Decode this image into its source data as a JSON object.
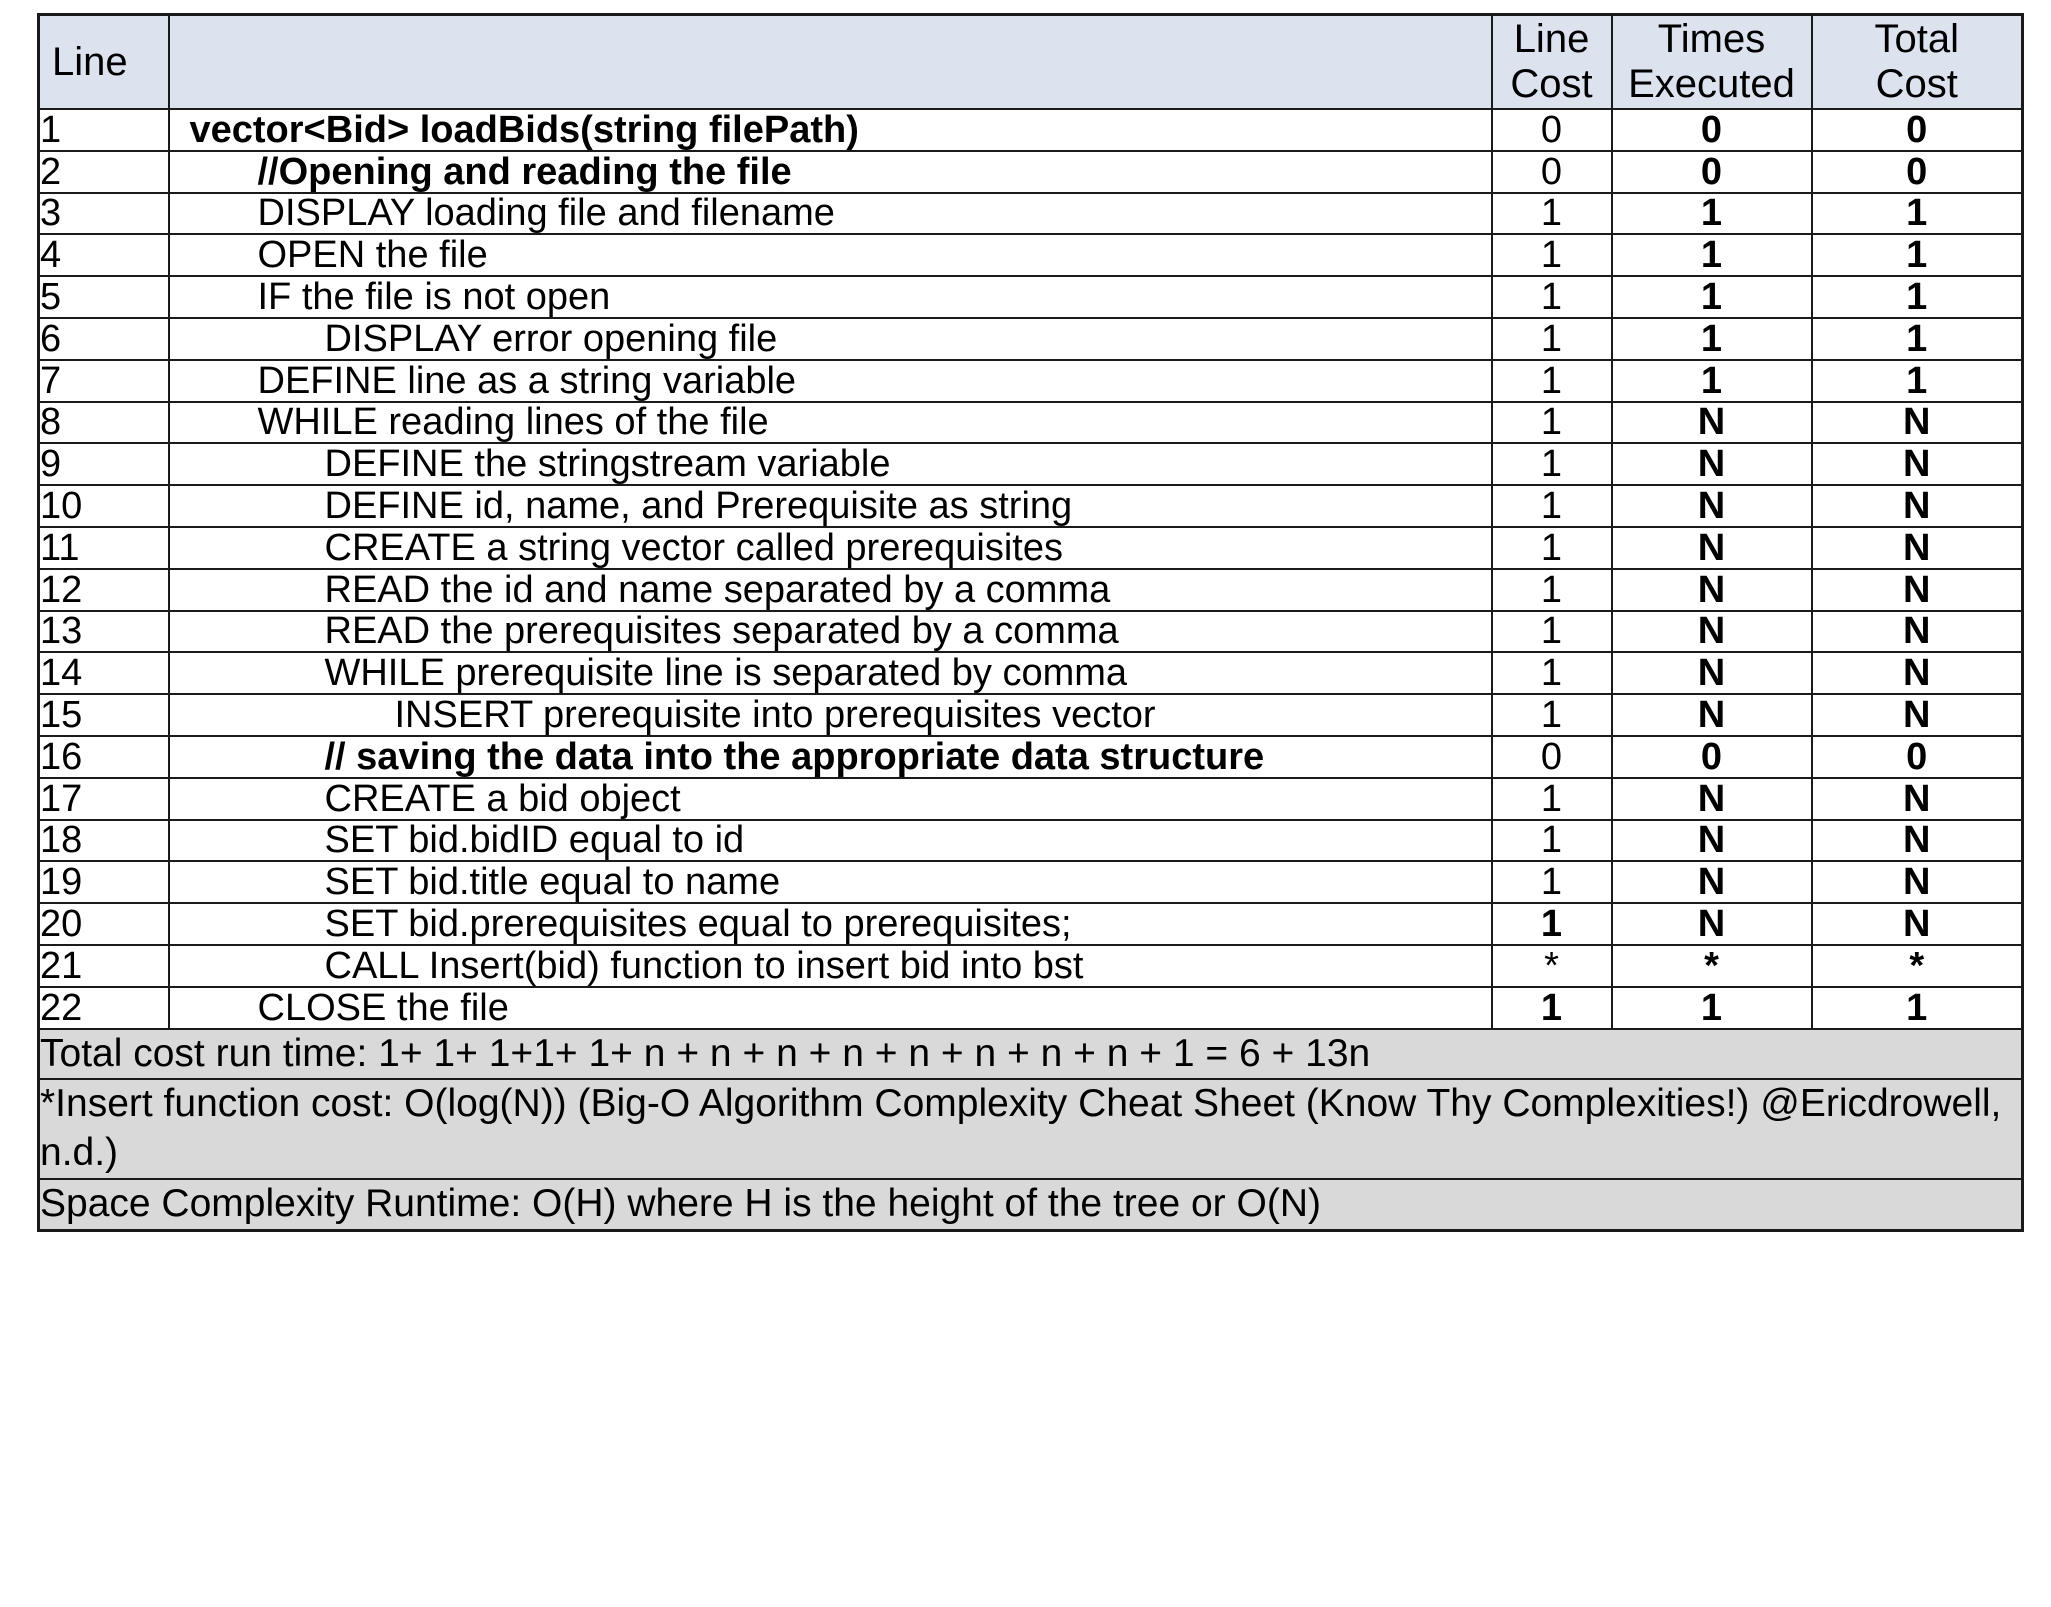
{
  "table": {
    "headers": {
      "line": "Line",
      "pseudocode": "",
      "line_cost": "Line\nCost",
      "line_cost_l1": "Line",
      "line_cost_l2": "Cost",
      "times_executed_l1": "Times",
      "times_executed_l2": "Executed",
      "total_cost_l1": "Total",
      "total_cost_l2": "Cost"
    },
    "rows": [
      {
        "line": "1",
        "text": "vector<Bid> loadBids(string filePath)",
        "indent": 0,
        "bold": true,
        "line_cost": "0",
        "line_cost_bold": false,
        "times": "0",
        "total": "0"
      },
      {
        "line": "2",
        "text": "//Opening and reading the file",
        "indent": 1,
        "bold": true,
        "line_cost": "0",
        "line_cost_bold": false,
        "times": "0",
        "total": "0"
      },
      {
        "line": "3",
        "text": "DISPLAY loading file and filename",
        "indent": 1,
        "bold": false,
        "line_cost": "1",
        "line_cost_bold": false,
        "times": "1",
        "total": "1"
      },
      {
        "line": "4",
        "text": "OPEN the file",
        "indent": 1,
        "bold": false,
        "line_cost": "1",
        "line_cost_bold": false,
        "times": "1",
        "total": "1"
      },
      {
        "line": "5",
        "text": "IF the file is not open",
        "indent": 1,
        "bold": false,
        "line_cost": "1",
        "line_cost_bold": false,
        "times": "1",
        "total": "1"
      },
      {
        "line": "6",
        "text": "DISPLAY error opening file",
        "indent": 2,
        "bold": false,
        "line_cost": "1",
        "line_cost_bold": false,
        "times": "1",
        "total": "1"
      },
      {
        "line": "7",
        "text": "DEFINE line as a string variable",
        "indent": 1,
        "bold": false,
        "line_cost": "1",
        "line_cost_bold": false,
        "times": "1",
        "total": "1"
      },
      {
        "line": "8",
        "text": "WHILE reading lines of the file",
        "indent": 1,
        "bold": false,
        "line_cost": "1",
        "line_cost_bold": false,
        "times": "N",
        "total": "N"
      },
      {
        "line": "9",
        "text": "DEFINE the stringstream variable",
        "indent": 2,
        "bold": false,
        "line_cost": "1",
        "line_cost_bold": false,
        "times": "N",
        "total": "N"
      },
      {
        "line": "10",
        "text": "DEFINE id, name, and Prerequisite as string",
        "indent": 2,
        "bold": false,
        "line_cost": "1",
        "line_cost_bold": false,
        "times": "N",
        "total": "N"
      },
      {
        "line": "11",
        "text": "CREATE a string vector called prerequisites",
        "indent": 2,
        "bold": false,
        "line_cost": "1",
        "line_cost_bold": false,
        "times": "N",
        "total": "N"
      },
      {
        "line": "12",
        "text": "READ the id and name separated by a comma",
        "indent": 2,
        "bold": false,
        "line_cost": "1",
        "line_cost_bold": false,
        "times": "N",
        "total": "N"
      },
      {
        "line": "13",
        "text": "READ the prerequisites separated by a comma",
        "indent": 2,
        "bold": false,
        "line_cost": "1",
        "line_cost_bold": false,
        "times": "N",
        "total": "N"
      },
      {
        "line": "14",
        "text": "WHILE prerequisite line is separated by comma",
        "indent": 2,
        "bold": false,
        "line_cost": "1",
        "line_cost_bold": false,
        "times": "N",
        "total": "N"
      },
      {
        "line": "15",
        "text": "INSERT prerequisite into prerequisites vector",
        "indent": 3,
        "bold": false,
        "line_cost": "1",
        "line_cost_bold": false,
        "times": "N",
        "total": "N"
      },
      {
        "line": "16",
        "text": "// saving the data into the appropriate data structure",
        "indent": 2,
        "bold": true,
        "line_cost": "0",
        "line_cost_bold": false,
        "times": "0",
        "total": "0"
      },
      {
        "line": "17",
        "text": "CREATE a bid object",
        "indent": 2,
        "bold": false,
        "line_cost": "1",
        "line_cost_bold": false,
        "times": "N",
        "total": "N"
      },
      {
        "line": "18",
        "text": "SET bid.bidID equal to id",
        "indent": 2,
        "bold": false,
        "line_cost": "1",
        "line_cost_bold": false,
        "times": "N",
        "total": "N"
      },
      {
        "line": "19",
        "text": "SET bid.title equal to name",
        "indent": 2,
        "bold": false,
        "line_cost": "1",
        "line_cost_bold": false,
        "times": "N",
        "total": "N"
      },
      {
        "line": "20",
        "text": "SET bid.prerequisites equal to prerequisites;",
        "indent": 2,
        "bold": false,
        "line_cost": "1",
        "line_cost_bold": true,
        "times": "N",
        "total": "N"
      },
      {
        "line": "21",
        "text": "CALL Insert(bid) function to insert bid into bst",
        "indent": 2,
        "bold": false,
        "line_cost": "*",
        "line_cost_bold": false,
        "times": "*",
        "total": "*"
      },
      {
        "line": "22",
        "text": "CLOSE the file",
        "indent": 1,
        "bold": false,
        "line_cost": "1",
        "line_cost_bold": true,
        "times": "1",
        "total": "1"
      }
    ],
    "footer": {
      "total_cost_run_time": "Total cost run time: 1+ 1+ 1+1+ 1+ n + n + n + n + n + n + n + n + 1 = 6 + 13n",
      "insert_function_cost_bold": "*Insert function cost: O(log(N))",
      "insert_function_cost_reg": " (Big-O Algorithm Complexity Cheat Sheet (Know Thy Complexities!) @Ericdrowell, n.d.)",
      "space_complexity": "Space Complexity Runtime: O(H) where H is the height of the tree or O(N)"
    }
  },
  "colors": {
    "header_bg": "#dce3ef",
    "footer_bg": "#d9d9d9",
    "border": "#1a1a1a",
    "text": "#000000",
    "page_bg": "#ffffff"
  }
}
